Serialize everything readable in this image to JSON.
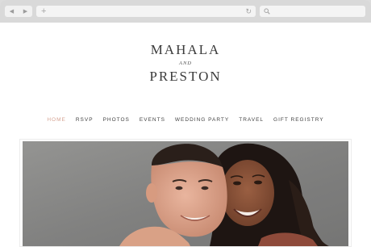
{
  "browser": {
    "back_icon": "back-arrow-icon",
    "forward_icon": "forward-arrow-icon",
    "back_glyph": "◀",
    "forward_glyph": "▶",
    "new_tab_glyph": "+",
    "reload_glyph": "↻",
    "url": "",
    "search_text": ""
  },
  "site": {
    "name_first": "MAHALA",
    "name_and": "AND",
    "name_second": "PRESTON"
  },
  "nav": {
    "items": [
      "HOME",
      "RSVP",
      "PHOTOS",
      "EVENTS",
      "WEDDING PARTY",
      "TRAVEL",
      "GIFT REGISTRY"
    ],
    "active_index": 0
  },
  "colors": {
    "accent": "#d6a393",
    "text": "#3b3b3b",
    "chrome": "#d9d9d9"
  }
}
